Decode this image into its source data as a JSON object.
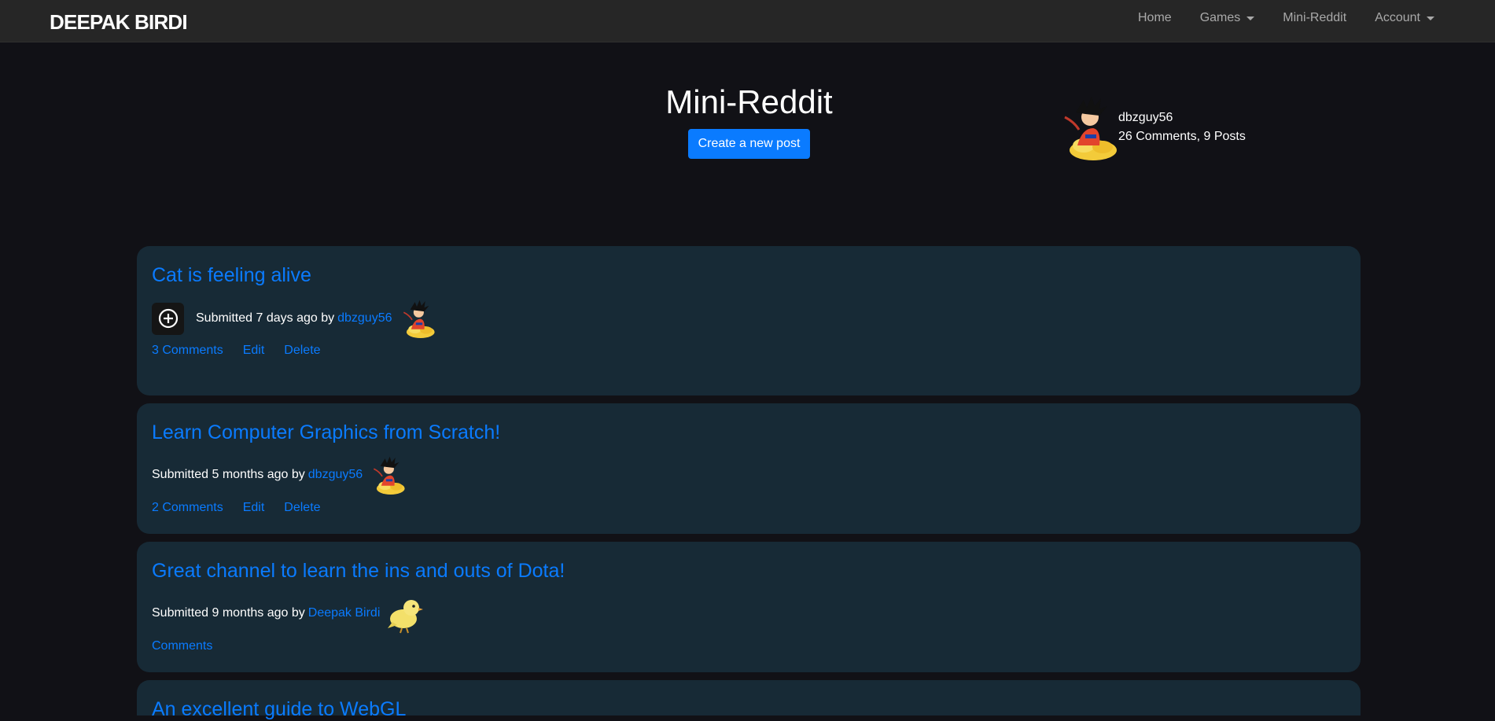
{
  "navbar": {
    "brand": "DEEPAK BIRDI",
    "links": [
      "Home",
      "Games",
      "Mini-Reddit",
      "Account"
    ]
  },
  "header": {
    "title": "Mini-Reddit",
    "create_button": "Create a new post"
  },
  "profile": {
    "username": "dbzguy56",
    "stats": "26 Comments, 9 Posts",
    "avatar_icon": "goku-on-cloud-icon"
  },
  "posts": [
    {
      "title": "Cat is feeling alive",
      "meta_prefix": "Submitted 7 days ago by",
      "author": "dbzguy56",
      "avatar_icon": "goku-on-cloud-icon",
      "vote_icon": "circle-plus-icon",
      "actions": [
        "3 Comments",
        "Edit",
        "Delete"
      ]
    },
    {
      "title": "Learn Computer Graphics from Scratch!",
      "meta_prefix": "Submitted 5 months ago by",
      "author": "dbzguy56",
      "avatar_icon": "goku-on-cloud-icon",
      "actions": [
        "2 Comments",
        "Edit",
        "Delete"
      ]
    },
    {
      "title": "Great channel to learn the ins and outs of Dota!",
      "meta_prefix": "Submitted 9 months ago by",
      "author": "Deepak Birdi",
      "avatar_icon": "yellow-bird-icon",
      "actions": [
        "Comments"
      ]
    },
    {
      "title": "An excellent guide to WebGL"
    }
  ],
  "colors": {
    "background": "#111116",
    "navbar": "#262626",
    "card": "#172a36",
    "link": "#0a7bff",
    "button": "#0a7bff"
  }
}
